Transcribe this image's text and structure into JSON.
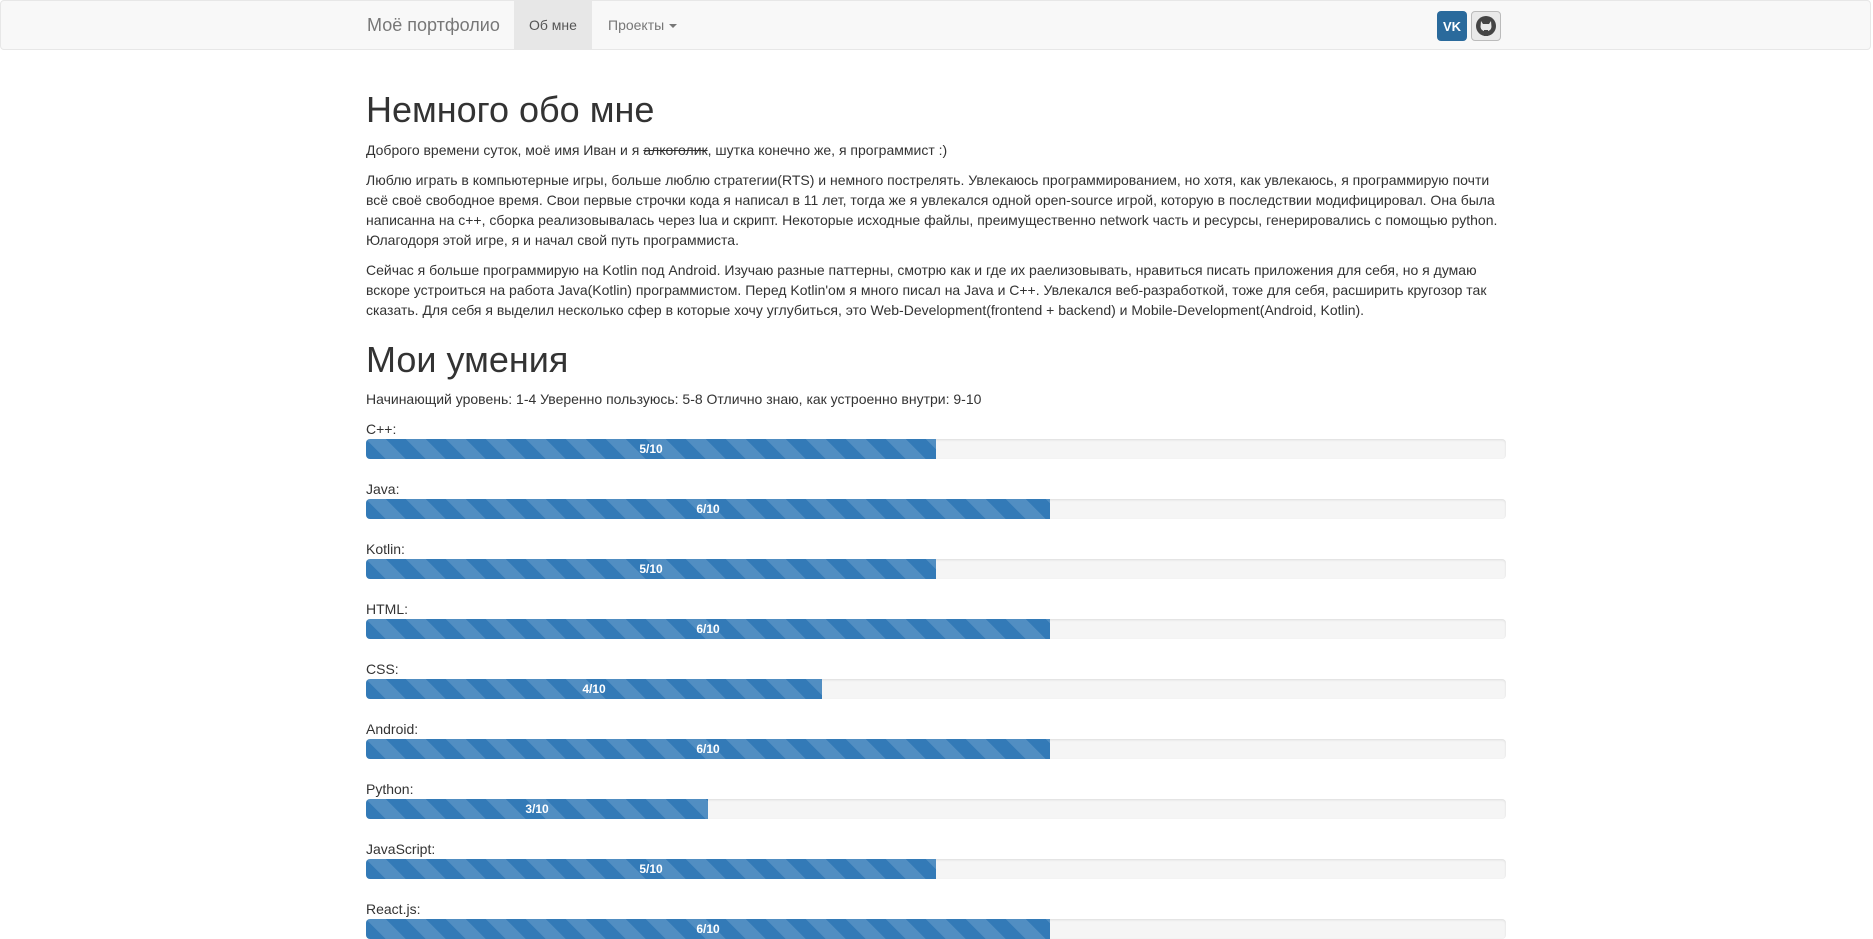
{
  "navbar": {
    "brand": "Моё портфолио",
    "items": [
      {
        "label": "Об мне",
        "active": true
      },
      {
        "label": "Проекты",
        "dropdown": true
      }
    ],
    "social": [
      {
        "name": "vk-icon",
        "label": "VK"
      },
      {
        "name": "github-icon",
        "label": ""
      }
    ]
  },
  "about": {
    "title": "Немного обо мне",
    "intro_before": "Доброго времени суток, моё имя Иван и я ",
    "intro_strike": "алкоголик",
    "intro_after": ", шутка конечно же, я программист :)",
    "p1": "Люблю играть в компьютерные игры, больше люблю стратегии(RTS) и немного пострелять. Увлекаюсь программированием, но хотя, как увлекаюсь, я программирую почти всё своё свободное время. Свои первые строчки кода я написал в 11 лет, тогда же я увлекался одной open-source игрой, которую в последствии модифицировал. Она была написанна на с++, сборка реализовывалась через lua и скрипт. Некоторые исходные файлы, преимущественно network часть и ресурсы, генерировались с помощью python. Юлагодоря этой игре, я и начал свой путь программиста.",
    "p2": "Сейчас я больше программирую на Kotlin под Android. Изучаю разные паттерны, смотрю как и где их раелизовывать, нравиться писать приложения для себя, но я думаю вскоре устроиться на работа Java(Kotlin) программистом. Перед Kotlin'ом я много писал на Java и С++. Увлекался веб-разработкой, тоже для себя, расширить кругозор так сказать. Для себя я выделил несколько сфер в которые хочу углубиться, это Web-Development(frontend + backend) и Mobile-Development(Android, Kotlin)."
  },
  "skills": {
    "title": "Мои умения",
    "legend": "Начинающий уровень: 1-4 Уверенно пользуюсь: 5-8 Отлично знаю, как устроенно внутри: 9-10",
    "max": 10,
    "items": [
      {
        "label": "C++:",
        "value": 5,
        "text": "5/10"
      },
      {
        "label": "Java:",
        "value": 6,
        "text": "6/10"
      },
      {
        "label": "Kotlin:",
        "value": 5,
        "text": "5/10"
      },
      {
        "label": "HTML:",
        "value": 6,
        "text": "6/10"
      },
      {
        "label": "CSS:",
        "value": 4,
        "text": "4/10"
      },
      {
        "label": "Android:",
        "value": 6,
        "text": "6/10"
      },
      {
        "label": "Python:",
        "value": 3,
        "text": "3/10"
      },
      {
        "label": "JavaScript:",
        "value": 5,
        "text": "5/10"
      },
      {
        "label": "React.js:",
        "value": 6,
        "text": "6/10"
      }
    ]
  },
  "colors": {
    "bar": "#337ab7",
    "track": "#f5f5f5",
    "vk": "#2a6a9c"
  }
}
